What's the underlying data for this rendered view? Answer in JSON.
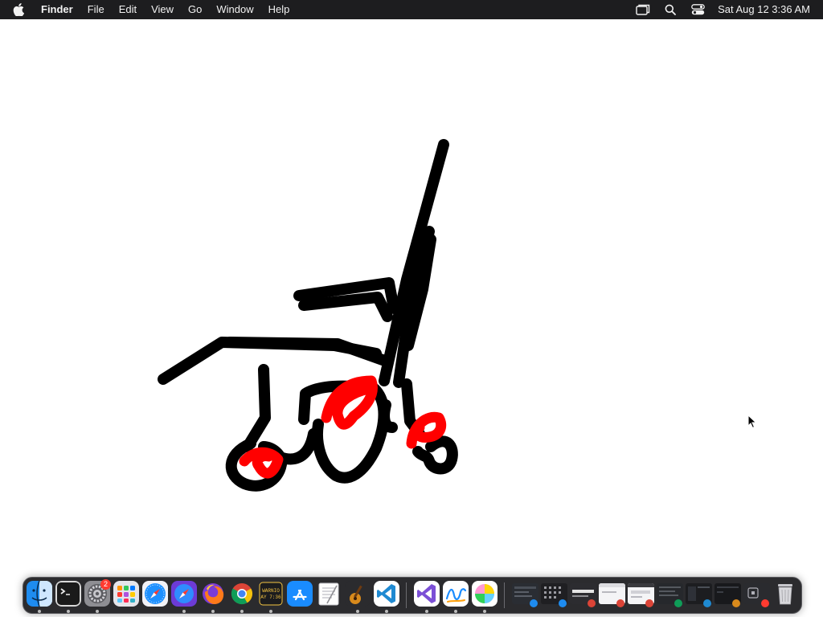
{
  "menubar": {
    "app_name": "Finder",
    "menus": [
      "File",
      "Edit",
      "View",
      "Go",
      "Window",
      "Help"
    ],
    "clock": "Sat Aug 12  3:36 AM",
    "status_icons": [
      "screen-mirroring-icon",
      "search-icon",
      "control-center-icon"
    ]
  },
  "drawing": {
    "stroke_colors": [
      "#000000",
      "#ff0000"
    ],
    "subject": "hand-drawn wheelchair sketch"
  },
  "dock": {
    "apps": [
      {
        "name": "Finder",
        "icon": "finder-icon",
        "running": true
      },
      {
        "name": "Terminal",
        "icon": "terminal-icon",
        "running": true
      },
      {
        "name": "System Settings",
        "icon": "settings-icon",
        "running": true,
        "badge": "2"
      },
      {
        "name": "Launchpad",
        "icon": "launchpad-icon",
        "running": false
      },
      {
        "name": "Safari",
        "icon": "safari-icon",
        "running": false
      },
      {
        "name": "Safari Technology Preview",
        "icon": "safari-preview-icon",
        "running": true
      },
      {
        "name": "Firefox",
        "icon": "firefox-icon",
        "running": true
      },
      {
        "name": "Chrome",
        "icon": "chrome-icon",
        "running": true
      },
      {
        "name": "Console",
        "icon": "console-icon",
        "running": true,
        "label_lines": [
          "WARNIO",
          "AY 7:36"
        ]
      },
      {
        "name": "App Store",
        "icon": "app-store-icon",
        "running": false
      },
      {
        "name": "TextEdit",
        "icon": "textedit-icon",
        "running": false
      },
      {
        "name": "GarageBand",
        "icon": "garageband-icon",
        "running": true
      },
      {
        "name": "Visual Studio Code",
        "icon": "vscode-icon",
        "running": true
      },
      {
        "name": "Visual Studio",
        "icon": "visual-studio-icon",
        "running": true
      },
      {
        "name": "Freeform",
        "icon": "freeform-icon",
        "running": true
      },
      {
        "name": "Pastel",
        "icon": "pastel-icon",
        "running": true
      }
    ],
    "minimized_windows": 9,
    "trash": {
      "name": "Trash",
      "icon": "trash-icon"
    }
  }
}
